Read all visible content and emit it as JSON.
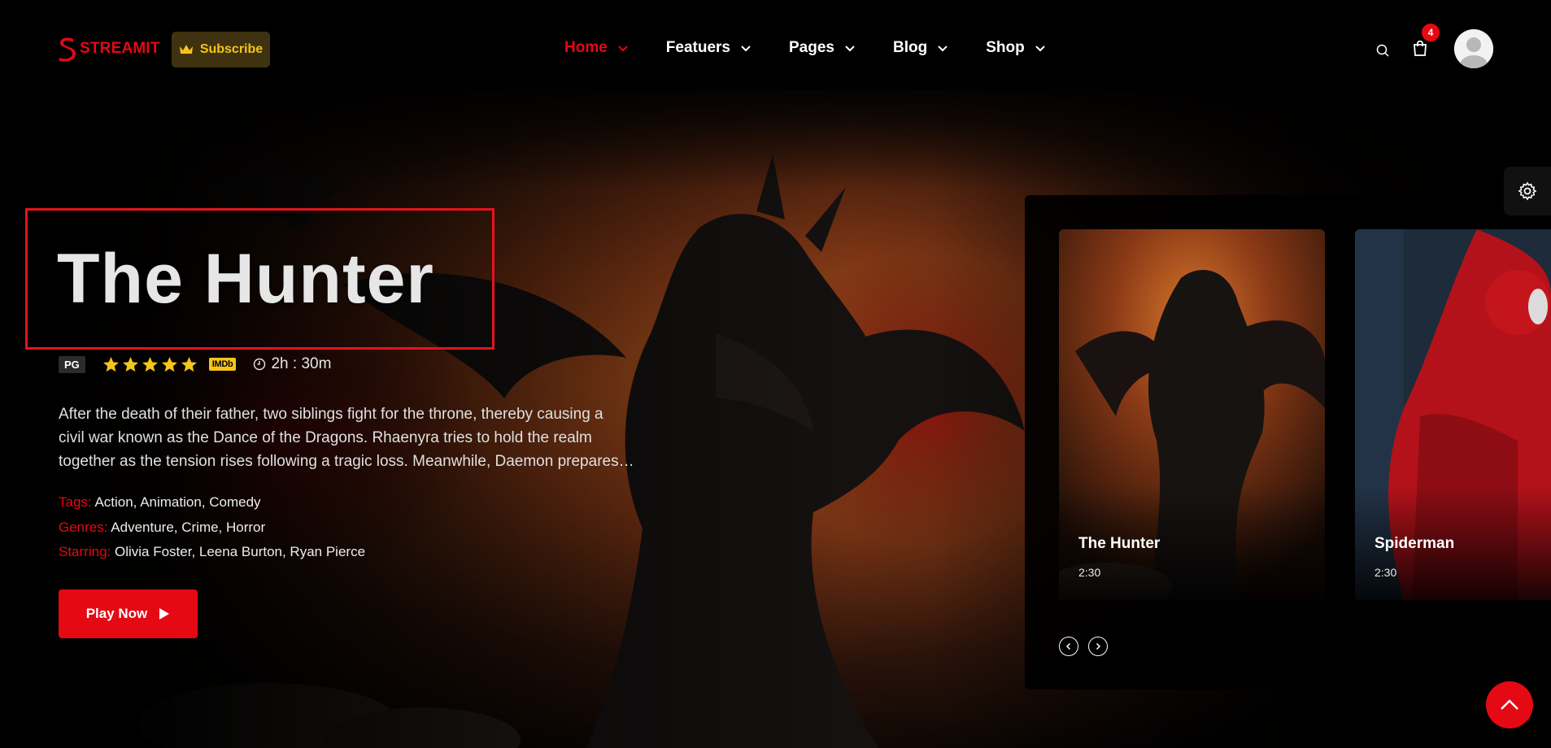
{
  "header": {
    "logo_text": "STREAMIT",
    "subscribe_label": "Subscribe",
    "nav": [
      {
        "label": "Home",
        "active": true
      },
      {
        "label": "Featuers",
        "active": false
      },
      {
        "label": "Pages",
        "active": false
      },
      {
        "label": "Blog",
        "active": false
      },
      {
        "label": "Shop",
        "active": false
      }
    ],
    "cart_count": "4",
    "icons": [
      "search-icon",
      "shopping-bag-icon",
      "user-avatar"
    ]
  },
  "hero": {
    "title": "The Hunter",
    "rating_badge": "PG",
    "stars": 5,
    "imdb_label": "IMDb",
    "duration": "2h : 30m",
    "description_lines": [
      "After the death of their father, two siblings fight for the throne, thereby causing a",
      "civil war known as the Dance of the Dragons. Rhaenyra tries to hold the realm",
      "together as the tension rises following a tragic loss. Meanwhile, Daemon prepares for war."
    ],
    "tags_label": "Tags:",
    "tags": "Action, Animation, Comedy",
    "genres_label": "Genres:",
    "genres": "Adventure, Crime, Horror",
    "starring_label": "Starring:",
    "starring": "Olivia Foster, Leena Burton, Ryan Pierce",
    "play_label": "Play Now"
  },
  "slider": {
    "cards": [
      {
        "title": "The Hunter",
        "time": "2:30"
      },
      {
        "title": "Spiderman",
        "time": "2:30"
      }
    ]
  },
  "colors": {
    "accent": "#e50914",
    "gold": "#f5c518",
    "background": "#000000"
  }
}
